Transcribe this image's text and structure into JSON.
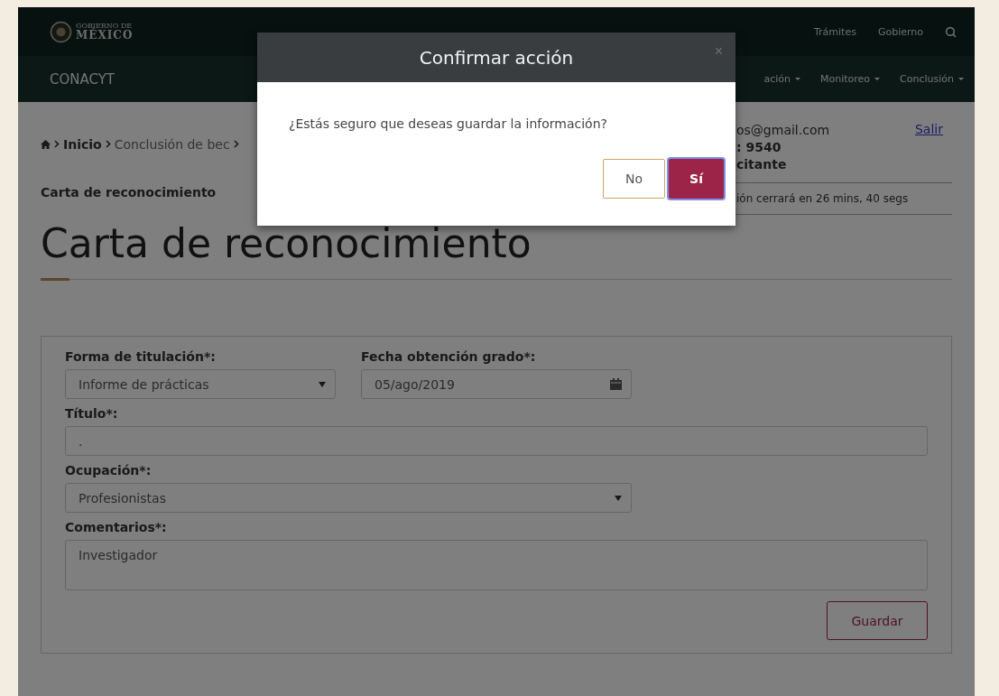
{
  "header": {
    "logo_small": "GOBIERNO DE",
    "logo_large": "MÉXICO",
    "links": [
      "Trámites",
      "Gobierno"
    ]
  },
  "nav": {
    "brand": "CONACYT",
    "menus": [
      "ación",
      "Monitoreo",
      "Conclusión"
    ]
  },
  "breadcrumb": [
    {
      "label": "Inicio",
      "kind": "link"
    },
    {
      "label": "Conclusión de bec",
      "kind": "plain"
    },
    {
      "label": "Carta de reconocimiento",
      "kind": "current"
    }
  ],
  "user": {
    "email": "os@gmail.com",
    "id": ": 9540",
    "role": "citante",
    "logout": "Salir",
    "session": "ión cerrará en 26 mins, 40 segs"
  },
  "title": "Carta de reconocimiento",
  "form": {
    "rows": [
      [
        {
          "kind": "select",
          "label": "Forma de titulación*:",
          "value": "Informe de prácticas"
        },
        {
          "kind": "date",
          "label": "Fecha obtención grado*:",
          "value": "05/ago/2019"
        }
      ],
      [
        {
          "kind": "text",
          "label": "Título*:",
          "value": "."
        }
      ],
      [
        {
          "kind": "select",
          "label": "Ocupación*:",
          "value": "Profesionistas"
        }
      ],
      [
        {
          "kind": "textarea",
          "label": "Comentarios*:",
          "value": "Investigador"
        }
      ]
    ],
    "submit": "Guardar"
  },
  "dialog": {
    "title": "Confirmar acción",
    "close": "×",
    "message": "¿Estás seguro que deseas guardar la información?",
    "buttons": [
      {
        "label": "No",
        "kind": "secondary"
      },
      {
        "label": "Sí",
        "kind": "primary"
      }
    ]
  }
}
